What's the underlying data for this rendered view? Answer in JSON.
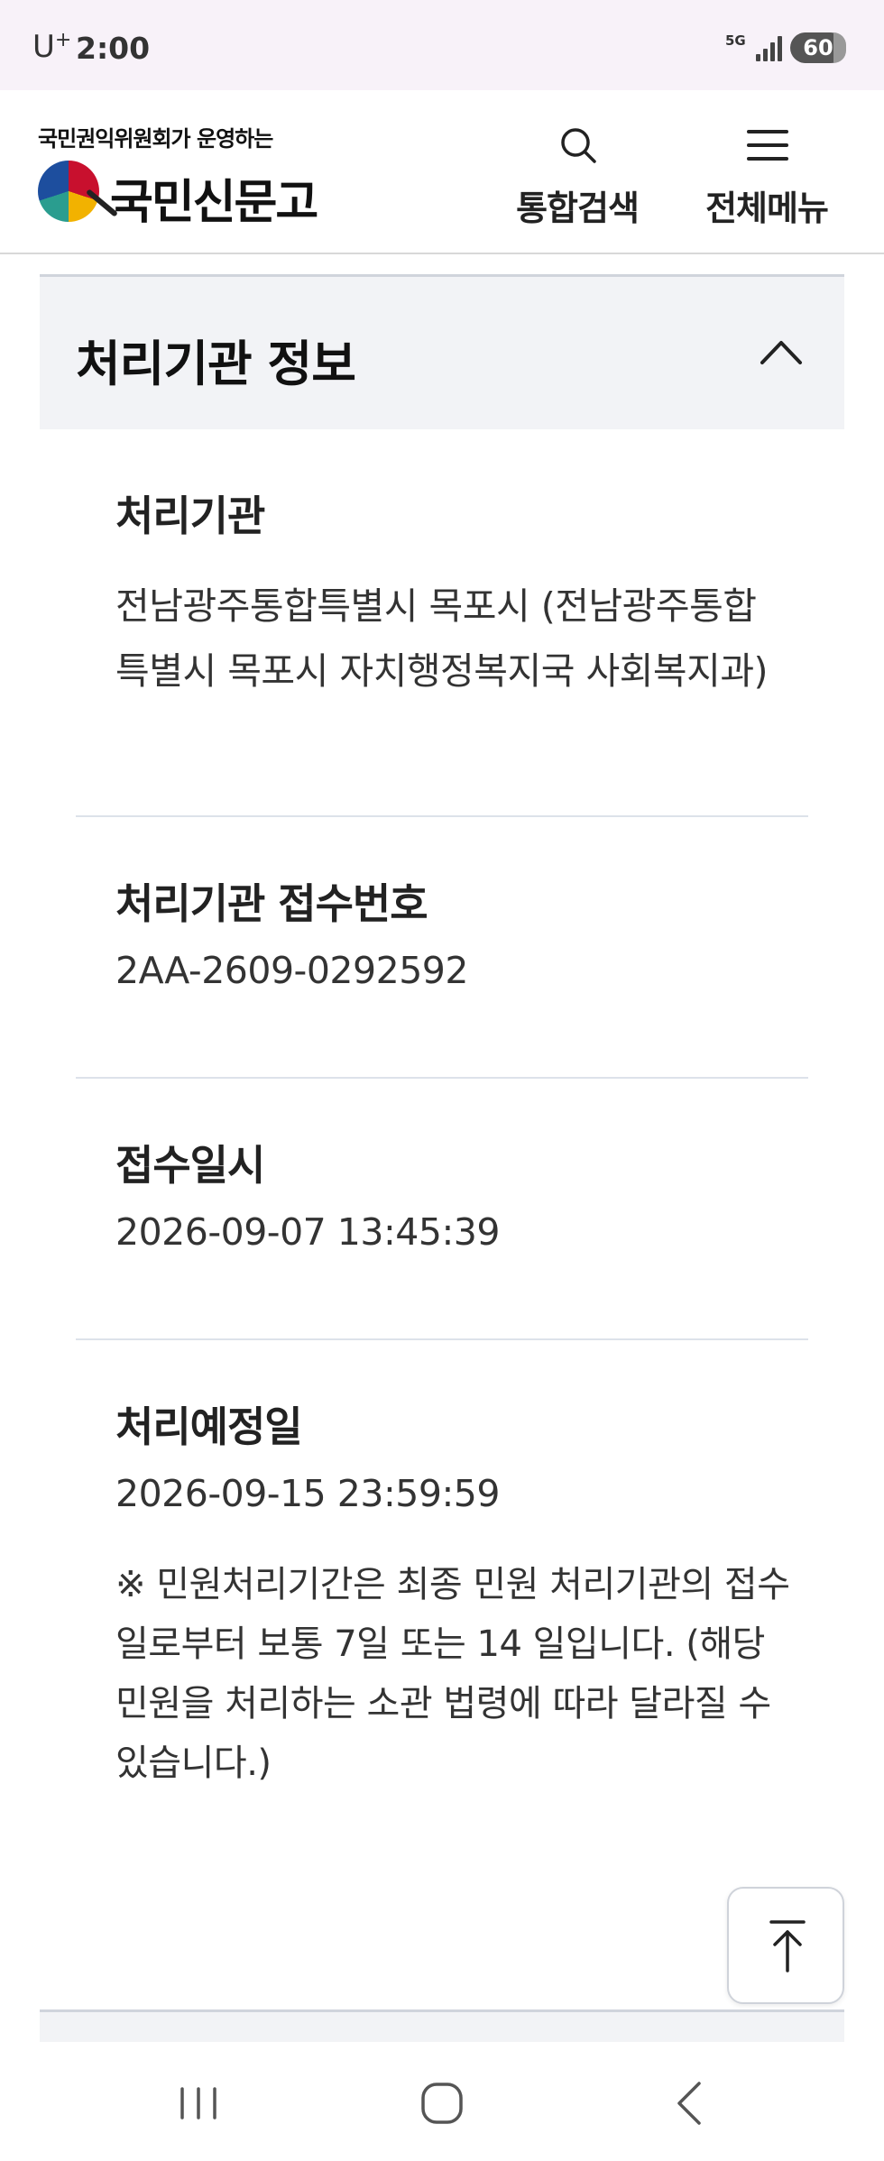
{
  "status_bar": {
    "carrier": "U",
    "carrier_sup": "+",
    "time": "2:00",
    "network": "5G",
    "battery": "60"
  },
  "header": {
    "logo_subtitle": "국민권익위원회가 운영하는",
    "logo_title": "국민신문고",
    "search_label": "통합검색",
    "menu_label": "전체메뉴"
  },
  "section": {
    "title": "처리기관 정보"
  },
  "items": [
    {
      "label": "처리기관",
      "value": "전남광주통합특별시 목포시 (전남광주통합특별시 목포시 자치행정복지국 사회복지과)"
    },
    {
      "label": "처리기관 접수번호",
      "value": "2AA-2609-0292592"
    },
    {
      "label": "접수일시",
      "value": "2026-09-07 13:45:39"
    },
    {
      "label": "처리예정일",
      "value": "2026-09-15 23:59:59"
    }
  ],
  "note": "※ 민원처리기간은 최종 민원 처리기관의 접수일로부터 보통 7일 또는 14 일입니다. (해당 민원을 처리하는 소관 법령에 따라 달라질 수 있습니다.)",
  "colors": {
    "status_bg": "#f8f2f9",
    "section_bg": "#f2f3f6",
    "divider": "#dde2ea"
  }
}
